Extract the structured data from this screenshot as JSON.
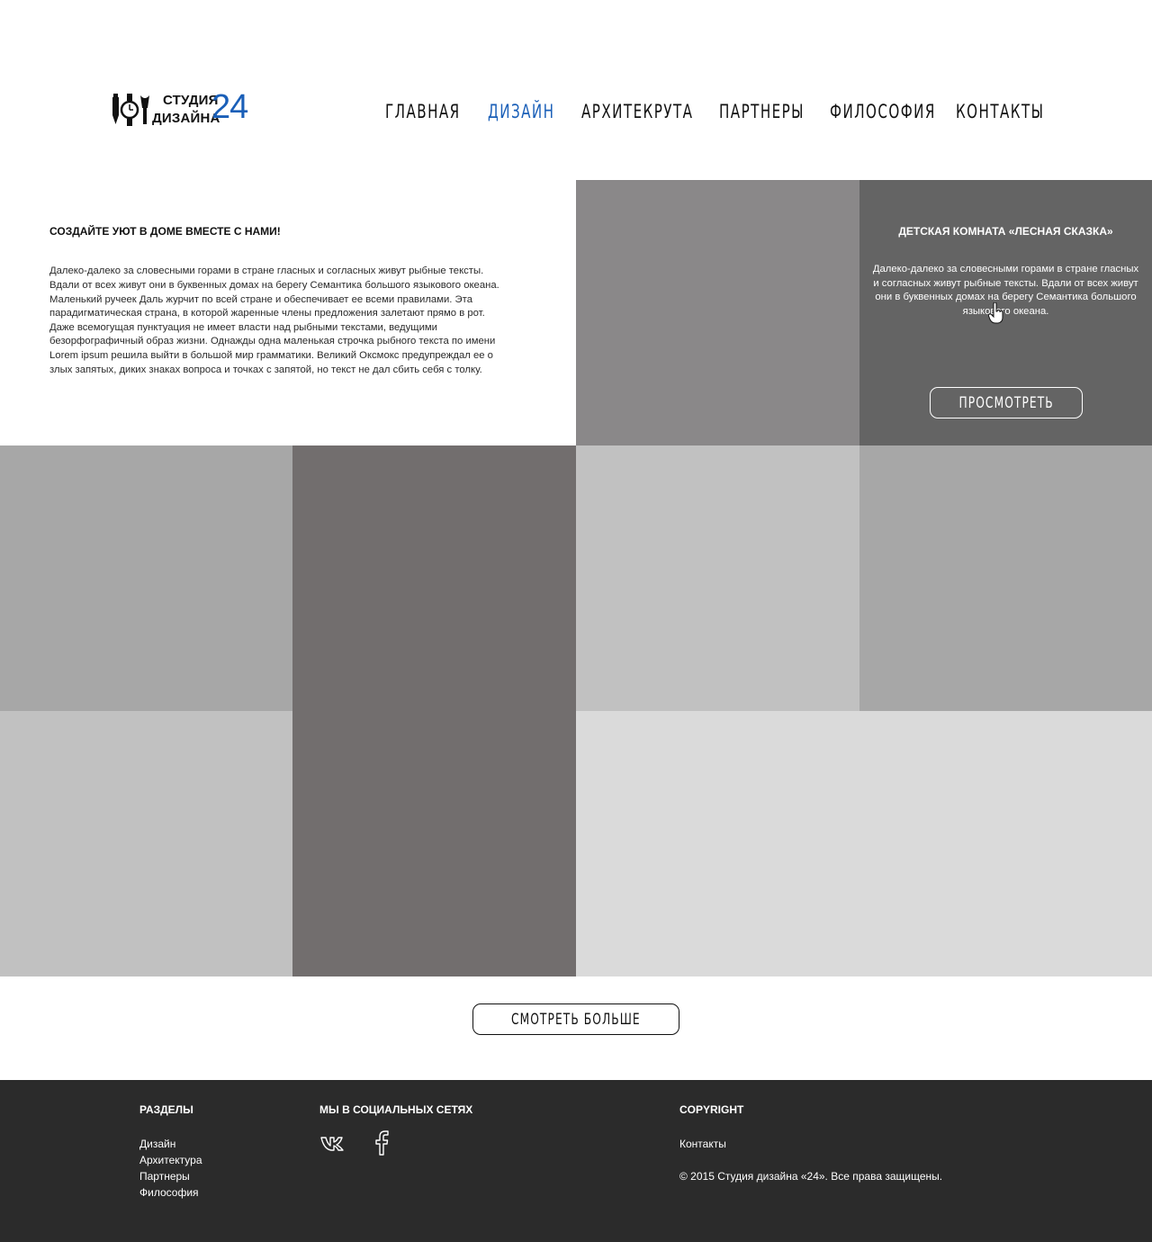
{
  "header": {
    "logo": {
      "word1": "СТУДИЯ",
      "word2": "ДИЗАЙНА",
      "number": "24",
      "icons": [
        "pencil-icon",
        "watch-icon",
        "brush-icon"
      ]
    },
    "nav": [
      {
        "label": "ГЛАВНАЯ",
        "active": false
      },
      {
        "label": "ДИЗАЙН",
        "active": true
      },
      {
        "label": "АРХИТЕКРУТА",
        "active": false
      },
      {
        "label": "ПАРТНЕРЫ",
        "active": false
      },
      {
        "label": "ФИЛОСОФИЯ",
        "active": false
      },
      {
        "label": "КОНТАКТЫ",
        "active": false
      }
    ]
  },
  "intro": {
    "title": "СОЗДАЙТЕ УЮТ В ДОМЕ ВМЕСТЕ С НАМИ!",
    "text": "Далеко-далеко за словесными горами в стране гласных и согласных живут рыбные тексты. Вдали от всех живут они в буквенных домах на берегу Семантика большого языкового океана. Маленький ручеек Даль журчит по всей стране и обеспечивает ее всеми правилами. Эта парадигматическая страна, в которой жаренные члены предложения залетают прямо в рот. Даже всемогущая пунктуация не имеет власти над рыбными текстами, ведущими безорфографичный образ жизни. Однажды одна маленькая строчка рыбного текста по имени Lorem ipsum решила выйти в большой мир грамматики. Великий Оксмокс предупреждал ее о злых запятых, диких знаках вопроса и точках с запятой, но текст не дал сбить себя с толку."
  },
  "feature": {
    "title": "ДЕТСКАЯ КОМНАТА «ЛЕСНАЯ СКАЗКА»",
    "text": "Далеко-далеко за словесными горами в стране гласных и согласных живут рыбные тексты. Вдали от всех живут они в буквенных домах на берегу Семантика большого языкового океана.",
    "button": "ПРОСМОТРЕТЬ"
  },
  "gallery": {
    "tile_colors": [
      "#8a8889",
      "#a7a7a7",
      "#726e6e",
      "#c1c1c1",
      "#a7a7a7",
      "#c1c1c1",
      "#dadada"
    ]
  },
  "more_button": "СМОТРЕТЬ БОЛЬШЕ",
  "footer": {
    "sections_title": "РАЗДЕЛЫ",
    "sections": [
      "Дизайн",
      "Архитектура",
      "Партнеры",
      "Философия"
    ],
    "social_title": "МЫ В СОЦИАЛЬНЫХ СЕТЯХ",
    "social": [
      "vk-icon",
      "facebook-icon"
    ],
    "copyright_title": "COPYRIGHT",
    "contacts_link": "Контакты",
    "copyright_text": "© 2015 Студия дизайна «24». Все права защищены."
  },
  "colors": {
    "accent": "#1a5fb8",
    "footer_bg": "#2b2b2b",
    "feature_bg": "#646464"
  }
}
